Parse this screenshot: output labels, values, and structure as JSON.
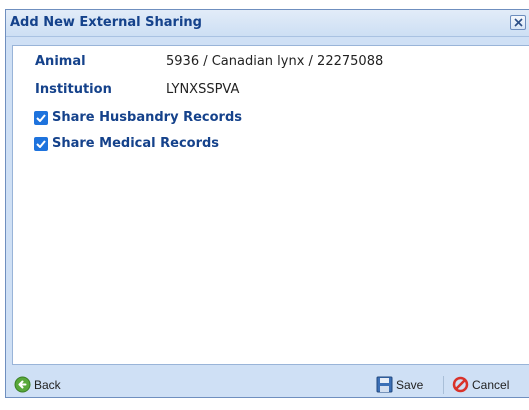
{
  "dialog": {
    "title": "Add New External Sharing",
    "close_icon": "close-icon"
  },
  "fields": {
    "animal_label": "Animal",
    "animal_value": "5936 / Canadian lynx / 22275088",
    "institution_label": "Institution",
    "institution_value": "LYNXSSPVA"
  },
  "options": {
    "husbandry_label": "Share Husbandry Records",
    "husbandry_checked": true,
    "medical_label": "Share Medical Records",
    "medical_checked": true
  },
  "footer": {
    "back_label": "Back",
    "back_icon": "back-arrow-icon",
    "save_label": "Save",
    "save_icon": "floppy-disk-icon",
    "cancel_label": "Cancel",
    "cancel_icon": "cancel-icon"
  },
  "colors": {
    "title_text": "#15428b",
    "dialog_background": "#cfe0f5",
    "checkbox_fill": "#1e73dd"
  }
}
